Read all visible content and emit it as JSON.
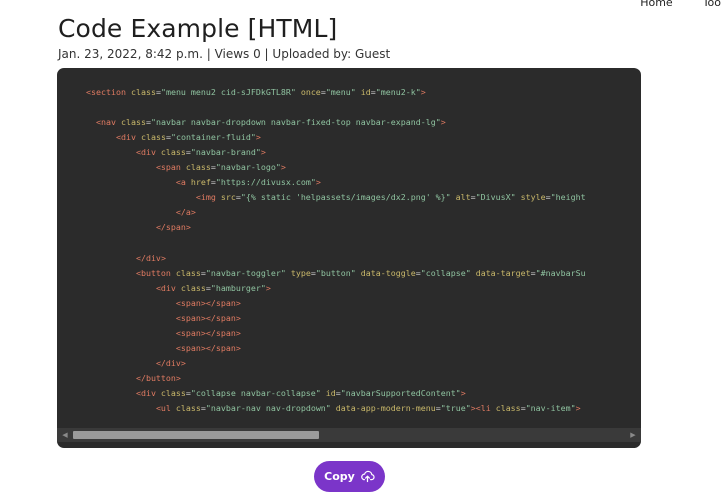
{
  "nav": {
    "items": [
      "Home",
      "Too"
    ]
  },
  "page": {
    "title": "Code Example [HTML]",
    "meta": "Jan. 23, 2022, 8:42 p.m. | Views 0 | Uploaded by: Guest"
  },
  "code": {
    "language": "HTML",
    "lines": [
      "<section class=\"menu menu2 cid-sJFDkGTL8R\" once=\"menu\" id=\"menu2-k\">",
      "",
      "  <nav class=\"navbar navbar-dropdown navbar-fixed-top navbar-expand-lg\">",
      "      <div class=\"container-fluid\">",
      "          <div class=\"navbar-brand\">",
      "              <span class=\"navbar-logo\">",
      "                  <a href=\"https://divusx.com\">",
      "                      <img src=\"{% static 'helpassets/images/dx2.png' %}\" alt=\"DivusX\" style=\"height",
      "                  </a>",
      "              </span>",
      "",
      "          </div>",
      "          <button class=\"navbar-toggler\" type=\"button\" data-toggle=\"collapse\" data-target=\"#navbarSu",
      "              <div class=\"hamburger\">",
      "                  <span></span>",
      "                  <span></span>",
      "                  <span></span>",
      "                  <span></span>",
      "              </div>",
      "          </button>",
      "          <div class=\"collapse navbar-collapse\" id=\"navbarSupportedContent\">",
      "              <ul class=\"navbar-nav nav-dropdown\" data-app-modern-menu=\"true\"><li class=\"nav-item\"><"
    ]
  },
  "copy_button": {
    "label": "Copy",
    "icon": "cloud-upload-icon"
  },
  "colors": {
    "accent": "#7b35c9",
    "code_bg": "#2b2b2b",
    "tag": "#e07b62",
    "attr": "#c9b86a",
    "value": "#8fc3a0"
  }
}
